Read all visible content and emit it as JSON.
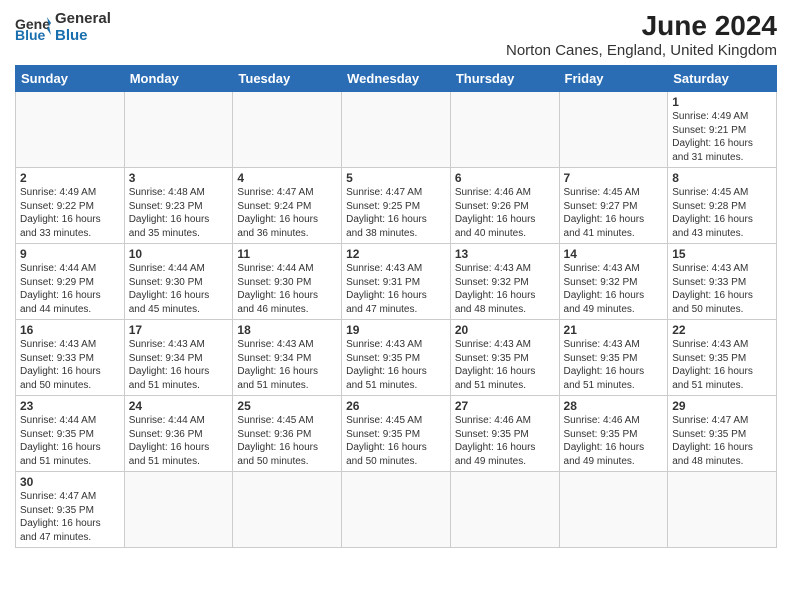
{
  "header": {
    "logo_general": "General",
    "logo_blue": "Blue",
    "title": "June 2024",
    "subtitle": "Norton Canes, England, United Kingdom"
  },
  "days_of_week": [
    "Sunday",
    "Monday",
    "Tuesday",
    "Wednesday",
    "Thursday",
    "Friday",
    "Saturday"
  ],
  "weeks": [
    [
      {
        "day": "",
        "info": ""
      },
      {
        "day": "",
        "info": ""
      },
      {
        "day": "",
        "info": ""
      },
      {
        "day": "",
        "info": ""
      },
      {
        "day": "",
        "info": ""
      },
      {
        "day": "",
        "info": ""
      },
      {
        "day": "1",
        "info": "Sunrise: 4:49 AM\nSunset: 9:21 PM\nDaylight: 16 hours\nand 31 minutes."
      }
    ],
    [
      {
        "day": "2",
        "info": "Sunrise: 4:49 AM\nSunset: 9:22 PM\nDaylight: 16 hours\nand 33 minutes."
      },
      {
        "day": "3",
        "info": "Sunrise: 4:48 AM\nSunset: 9:23 PM\nDaylight: 16 hours\nand 35 minutes."
      },
      {
        "day": "4",
        "info": "Sunrise: 4:47 AM\nSunset: 9:24 PM\nDaylight: 16 hours\nand 36 minutes."
      },
      {
        "day": "5",
        "info": "Sunrise: 4:47 AM\nSunset: 9:25 PM\nDaylight: 16 hours\nand 38 minutes."
      },
      {
        "day": "6",
        "info": "Sunrise: 4:46 AM\nSunset: 9:26 PM\nDaylight: 16 hours\nand 40 minutes."
      },
      {
        "day": "7",
        "info": "Sunrise: 4:45 AM\nSunset: 9:27 PM\nDaylight: 16 hours\nand 41 minutes."
      },
      {
        "day": "8",
        "info": "Sunrise: 4:45 AM\nSunset: 9:28 PM\nDaylight: 16 hours\nand 43 minutes."
      }
    ],
    [
      {
        "day": "9",
        "info": "Sunrise: 4:44 AM\nSunset: 9:29 PM\nDaylight: 16 hours\nand 44 minutes."
      },
      {
        "day": "10",
        "info": "Sunrise: 4:44 AM\nSunset: 9:30 PM\nDaylight: 16 hours\nand 45 minutes."
      },
      {
        "day": "11",
        "info": "Sunrise: 4:44 AM\nSunset: 9:30 PM\nDaylight: 16 hours\nand 46 minutes."
      },
      {
        "day": "12",
        "info": "Sunrise: 4:43 AM\nSunset: 9:31 PM\nDaylight: 16 hours\nand 47 minutes."
      },
      {
        "day": "13",
        "info": "Sunrise: 4:43 AM\nSunset: 9:32 PM\nDaylight: 16 hours\nand 48 minutes."
      },
      {
        "day": "14",
        "info": "Sunrise: 4:43 AM\nSunset: 9:32 PM\nDaylight: 16 hours\nand 49 minutes."
      },
      {
        "day": "15",
        "info": "Sunrise: 4:43 AM\nSunset: 9:33 PM\nDaylight: 16 hours\nand 50 minutes."
      }
    ],
    [
      {
        "day": "16",
        "info": "Sunrise: 4:43 AM\nSunset: 9:33 PM\nDaylight: 16 hours\nand 50 minutes."
      },
      {
        "day": "17",
        "info": "Sunrise: 4:43 AM\nSunset: 9:34 PM\nDaylight: 16 hours\nand 51 minutes."
      },
      {
        "day": "18",
        "info": "Sunrise: 4:43 AM\nSunset: 9:34 PM\nDaylight: 16 hours\nand 51 minutes."
      },
      {
        "day": "19",
        "info": "Sunrise: 4:43 AM\nSunset: 9:35 PM\nDaylight: 16 hours\nand 51 minutes."
      },
      {
        "day": "20",
        "info": "Sunrise: 4:43 AM\nSunset: 9:35 PM\nDaylight: 16 hours\nand 51 minutes."
      },
      {
        "day": "21",
        "info": "Sunrise: 4:43 AM\nSunset: 9:35 PM\nDaylight: 16 hours\nand 51 minutes."
      },
      {
        "day": "22",
        "info": "Sunrise: 4:43 AM\nSunset: 9:35 PM\nDaylight: 16 hours\nand 51 minutes."
      }
    ],
    [
      {
        "day": "23",
        "info": "Sunrise: 4:44 AM\nSunset: 9:35 PM\nDaylight: 16 hours\nand 51 minutes."
      },
      {
        "day": "24",
        "info": "Sunrise: 4:44 AM\nSunset: 9:36 PM\nDaylight: 16 hours\nand 51 minutes."
      },
      {
        "day": "25",
        "info": "Sunrise: 4:45 AM\nSunset: 9:36 PM\nDaylight: 16 hours\nand 50 minutes."
      },
      {
        "day": "26",
        "info": "Sunrise: 4:45 AM\nSunset: 9:35 PM\nDaylight: 16 hours\nand 50 minutes."
      },
      {
        "day": "27",
        "info": "Sunrise: 4:46 AM\nSunset: 9:35 PM\nDaylight: 16 hours\nand 49 minutes."
      },
      {
        "day": "28",
        "info": "Sunrise: 4:46 AM\nSunset: 9:35 PM\nDaylight: 16 hours\nand 49 minutes."
      },
      {
        "day": "29",
        "info": "Sunrise: 4:47 AM\nSunset: 9:35 PM\nDaylight: 16 hours\nand 48 minutes."
      }
    ],
    [
      {
        "day": "30",
        "info": "Sunrise: 4:47 AM\nSunset: 9:35 PM\nDaylight: 16 hours\nand 47 minutes."
      },
      {
        "day": "",
        "info": ""
      },
      {
        "day": "",
        "info": ""
      },
      {
        "day": "",
        "info": ""
      },
      {
        "day": "",
        "info": ""
      },
      {
        "day": "",
        "info": ""
      },
      {
        "day": "",
        "info": ""
      }
    ]
  ]
}
